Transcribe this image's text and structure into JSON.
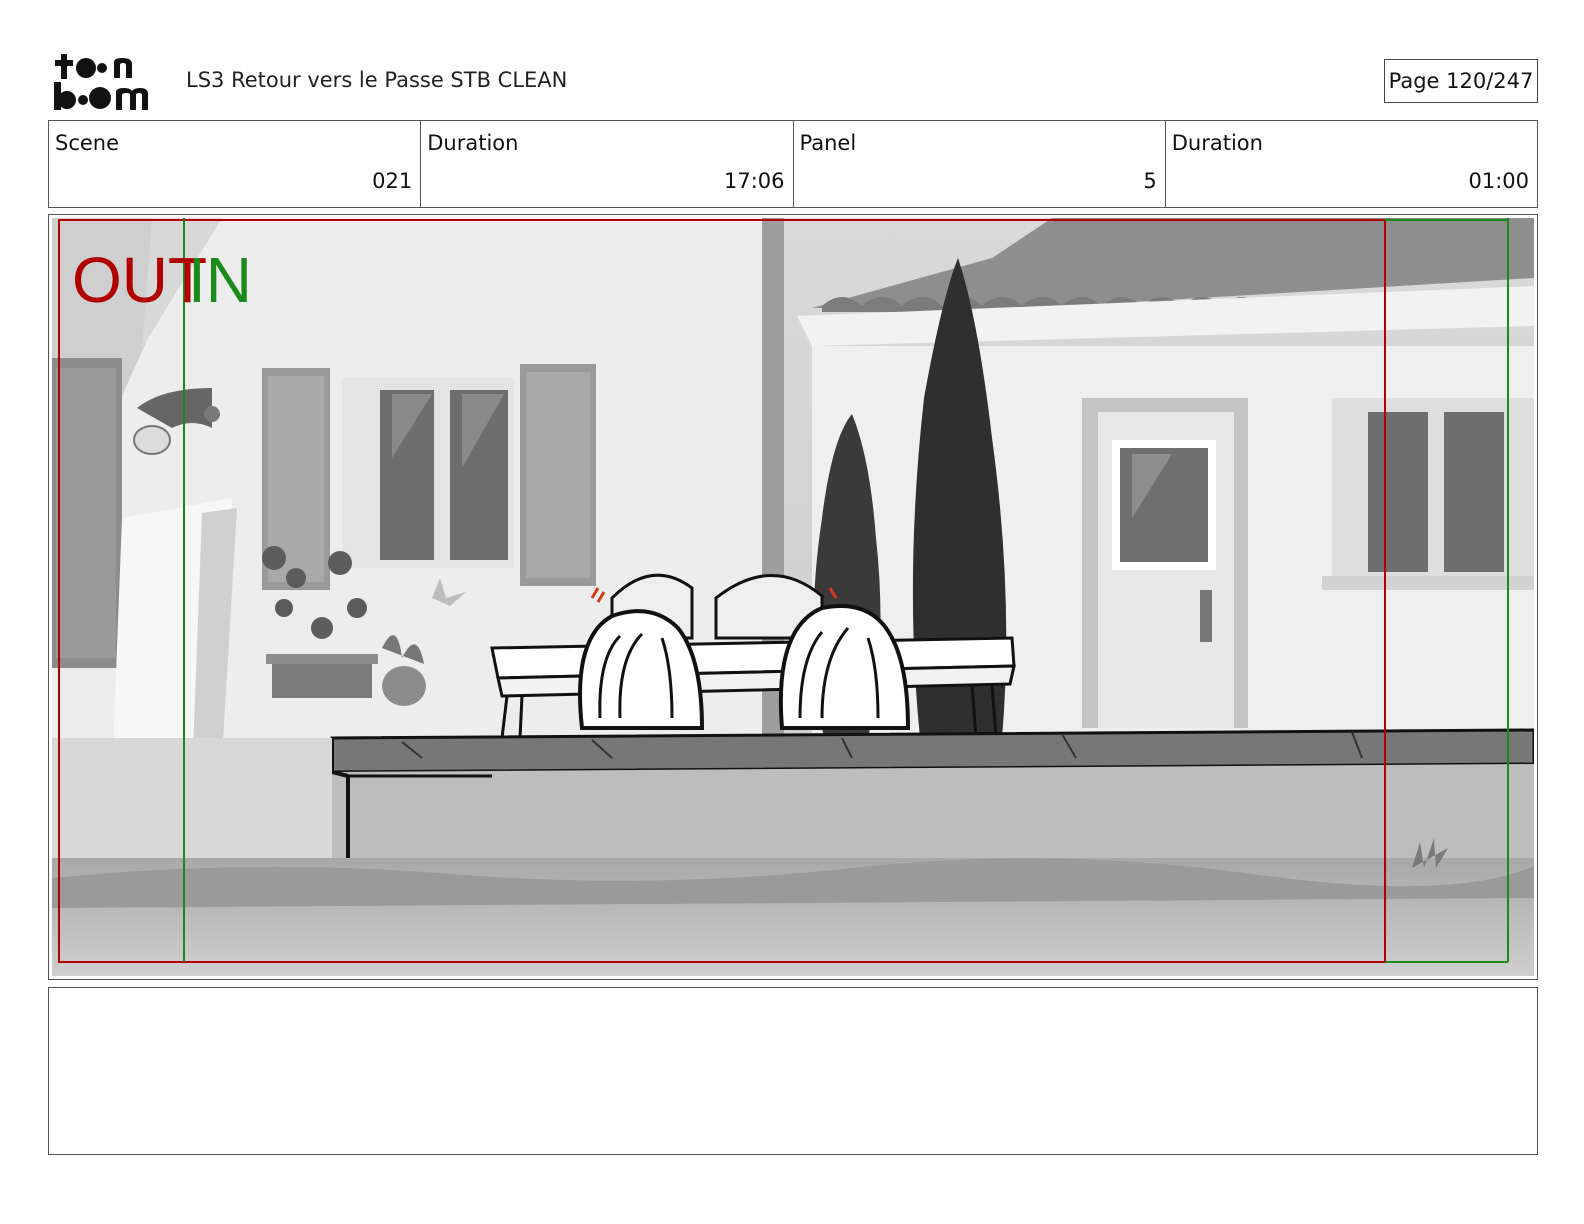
{
  "header": {
    "doc_title": "LS3 Retour vers le Passe STB CLEAN",
    "page_label": "Page 120/247",
    "logo_text": "toon boom"
  },
  "info": {
    "scene_label": "Scene",
    "scene_value": "021",
    "scene_duration_label": "Duration",
    "scene_duration_value": "17:06",
    "panel_label": "Panel",
    "panel_value": "5",
    "panel_duration_label": "Duration",
    "panel_duration_value": "01:00"
  },
  "panel": {
    "out_label": "OUT",
    "in_label": "IN",
    "out_color": "#b00000",
    "in_color": "#1a8a1a"
  },
  "notes": {
    "text": ""
  }
}
